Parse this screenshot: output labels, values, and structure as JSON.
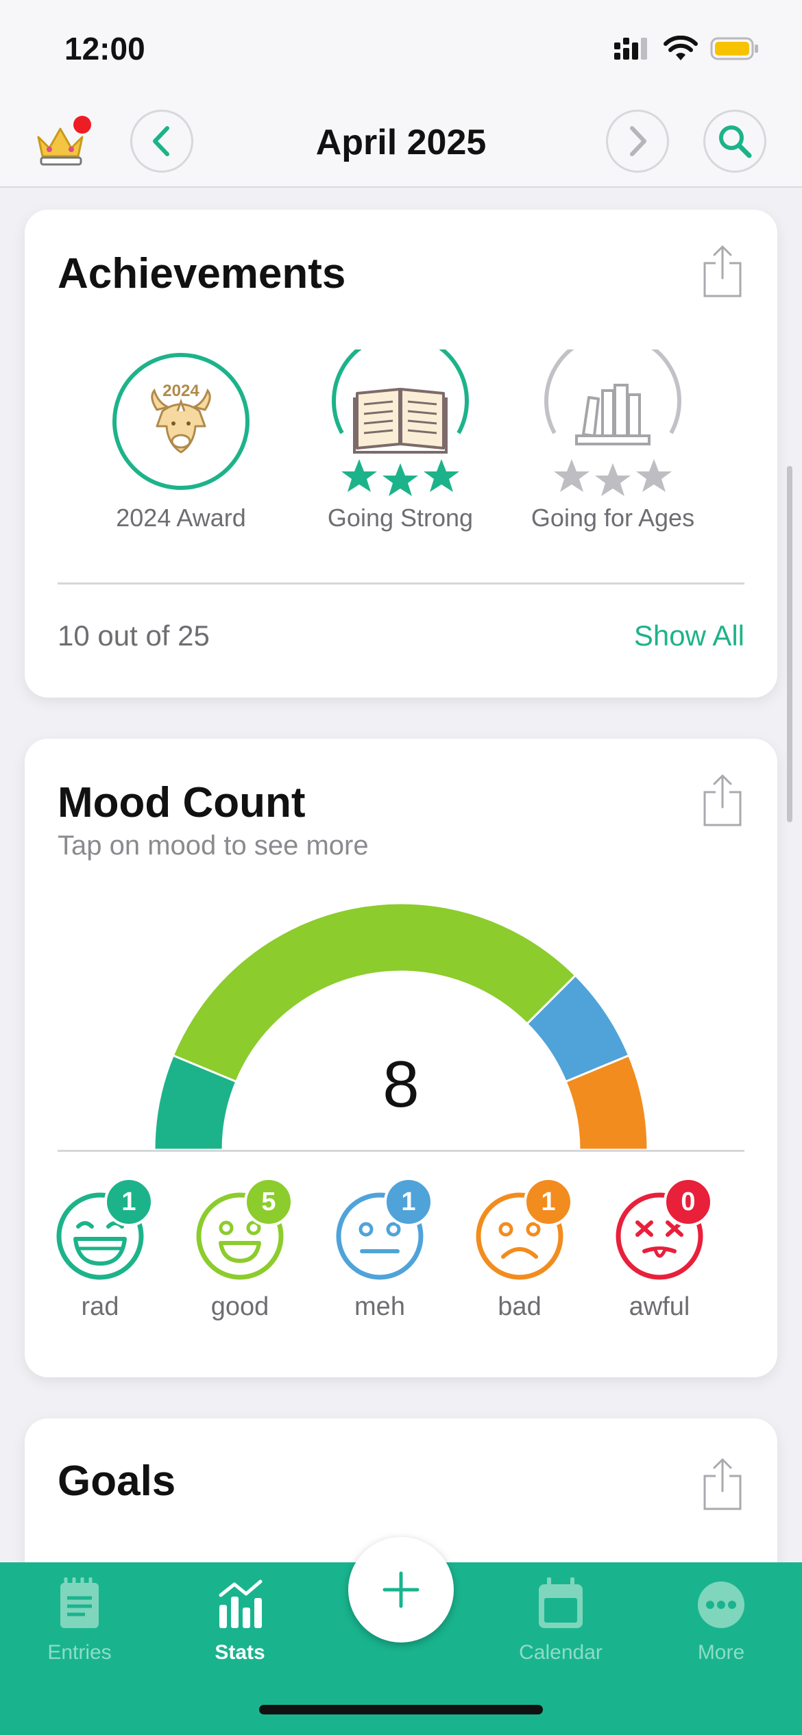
{
  "status_bar": {
    "time": "12:00"
  },
  "nav": {
    "title": "April 2025"
  },
  "achievements": {
    "title": "Achievements",
    "items": [
      {
        "label": "2024 Award",
        "badge_text": "2024"
      },
      {
        "label": "Going Strong"
      },
      {
        "label": "Going for Ages"
      }
    ],
    "count_text": "10 out of 25",
    "show_all": "Show All"
  },
  "mood_count": {
    "title": "Mood Count",
    "subtitle": "Tap on mood to see more",
    "total": "8",
    "moods": [
      {
        "label": "rad",
        "count": "1",
        "color": "#1db38a"
      },
      {
        "label": "good",
        "count": "5",
        "color": "#8ccc2c"
      },
      {
        "label": "meh",
        "count": "1",
        "color": "#4fa3d9"
      },
      {
        "label": "bad",
        "count": "1",
        "color": "#f28c1e"
      },
      {
        "label": "awful",
        "count": "0",
        "color": "#e8203a"
      }
    ]
  },
  "goals": {
    "title": "Goals"
  },
  "tabs": [
    {
      "label": "Entries"
    },
    {
      "label": "Stats"
    },
    {
      "label": "Calendar"
    },
    {
      "label": "More"
    }
  ],
  "colors": {
    "accent": "#1db38a",
    "tab_bar": "#19b48e"
  }
}
